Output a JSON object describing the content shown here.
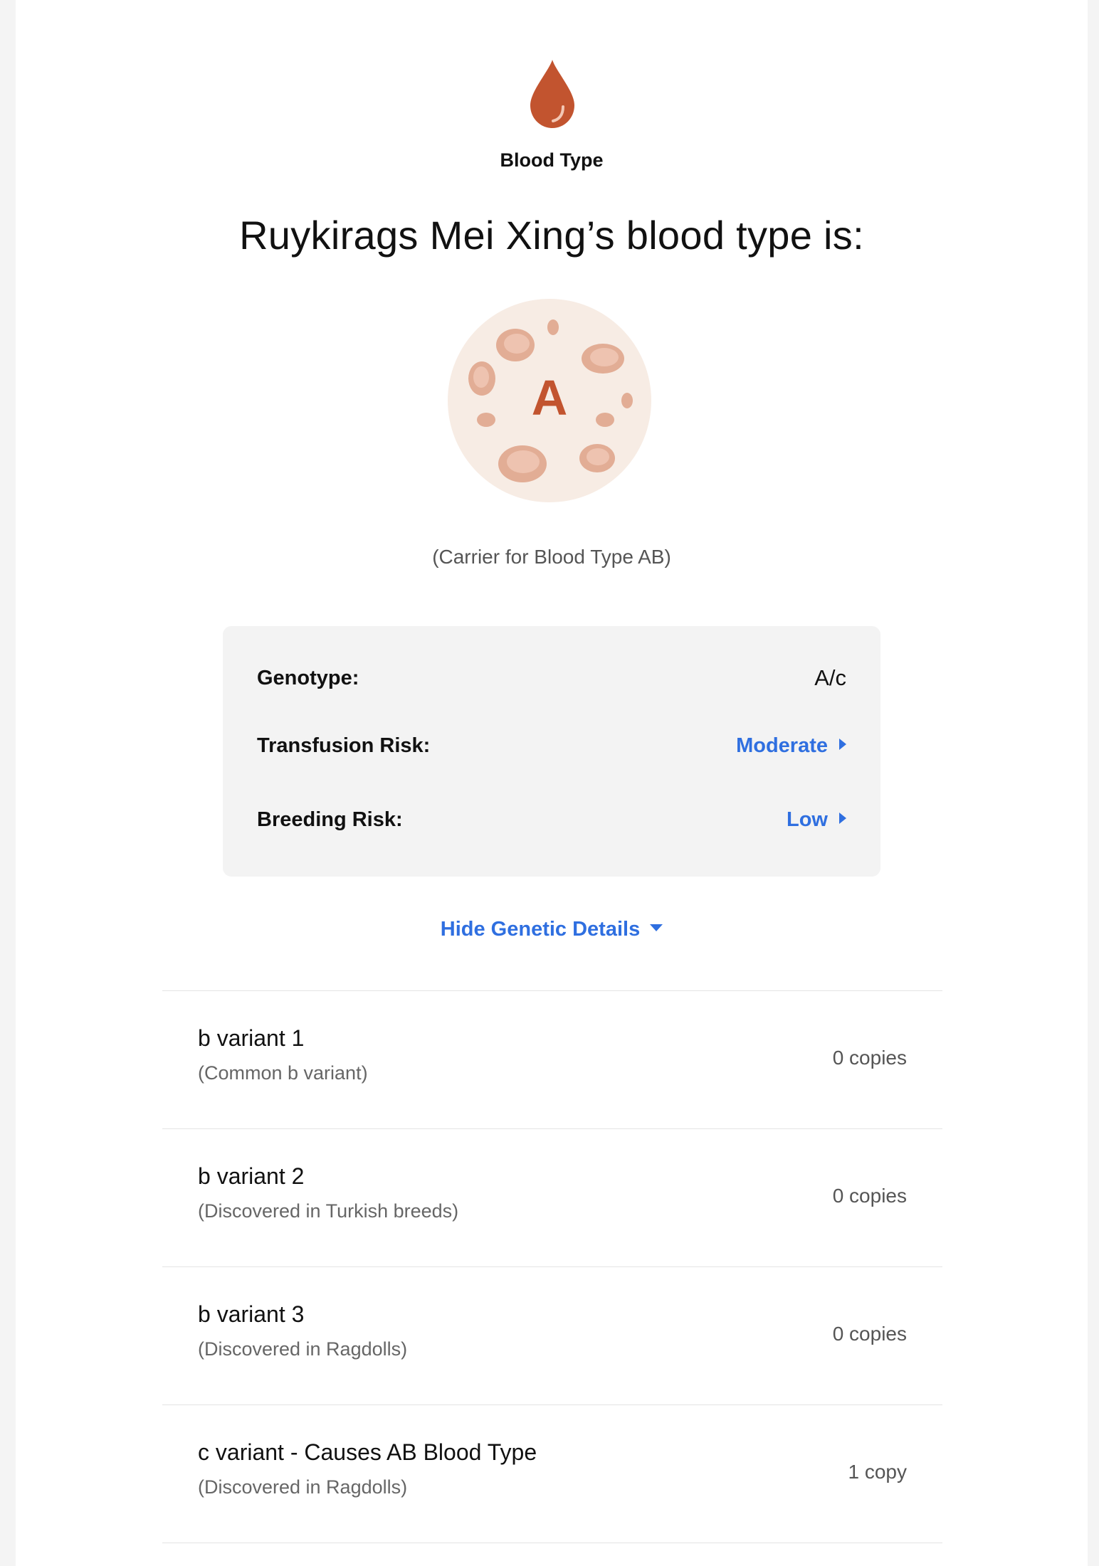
{
  "header": {
    "section_label": "Blood Type",
    "headline": "Ruykirags Mei Xing’s blood type is:",
    "blood_type_letter": "A",
    "carrier_note": "(Carrier for Blood Type AB)"
  },
  "colors": {
    "drop": "#c2542f",
    "badge_bg": "#f7ece4",
    "badge_letter": "#c2542f",
    "cell": "#e2ad95",
    "link": "#2f6fe0"
  },
  "icons": {
    "section": "blood-drop-icon",
    "badge": "blood-cells-icon"
  },
  "info": {
    "genotype_label": "Genotype:",
    "genotype_value": "A/c",
    "transfusion_label": "Transfusion Risk:",
    "transfusion_value": "Moderate",
    "breeding_label": "Breeding Risk:",
    "breeding_value": "Low"
  },
  "toggle_label": "Hide Genetic Details",
  "variants": [
    {
      "name": "b variant 1",
      "desc": "(Common b variant)",
      "count": "0 copies"
    },
    {
      "name": "b variant 2",
      "desc": "(Discovered in Turkish breeds)",
      "count": "0 copies"
    },
    {
      "name": "b variant 3",
      "desc": "(Discovered in Ragdolls)",
      "count": "0 copies"
    },
    {
      "name": "c variant - Causes AB Blood Type",
      "desc": "(Discovered in Ragdolls)",
      "count": "1 copy"
    }
  ]
}
